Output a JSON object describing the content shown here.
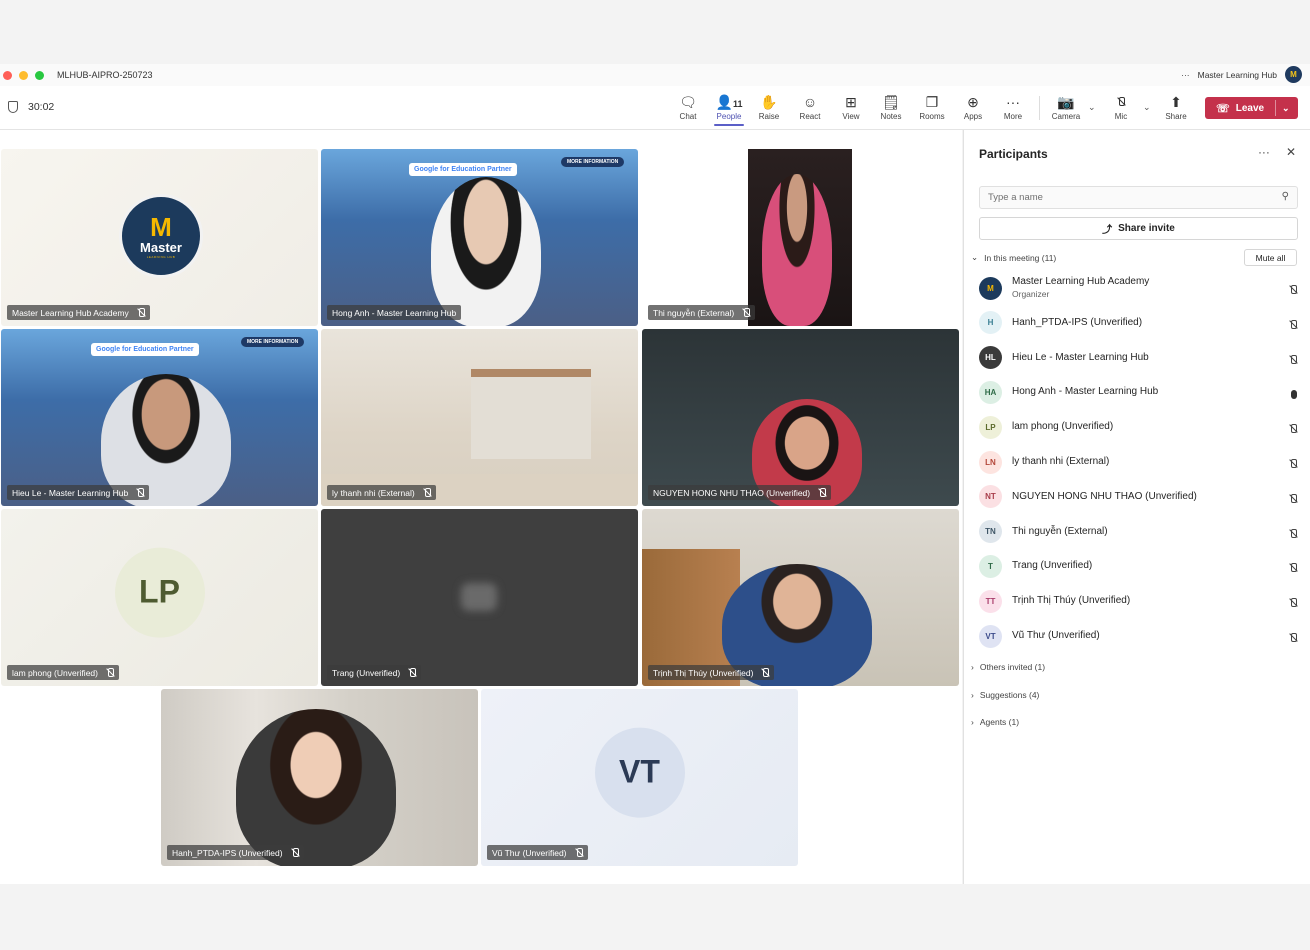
{
  "window": {
    "title": "MLHUB-AIPRO-250723",
    "org_name": "Master Learning Hub",
    "org_avatar": "M"
  },
  "toolbar": {
    "timer": "30:02",
    "chat": "Chat",
    "people": "People",
    "people_count": "11",
    "raise": "Raise",
    "react": "React",
    "view": "View",
    "notes": "Notes",
    "rooms": "Rooms",
    "apps": "Apps",
    "more": "More",
    "camera": "Camera",
    "mic": "Mic",
    "share": "Share",
    "leave": "Leave"
  },
  "tiles": [
    {
      "name": "Master Learning Hub Academy"
    },
    {
      "name": "Hong Anh - Master Learning Hub"
    },
    {
      "name": "Thi nguyễn (External)"
    },
    {
      "name": "Hieu Le - Master Learning Hub"
    },
    {
      "name": "ly thanh nhi (External)"
    },
    {
      "name": "NGUYEN HONG NHU THAO (Unverified)"
    },
    {
      "name": "lam phong (Unverified)",
      "initials": "LP"
    },
    {
      "name": "Trang (Unverified)"
    },
    {
      "name": "Trịnh Thị Thúy (Unverified)"
    },
    {
      "name": "Hanh_PTDA-IPS (Unverified)"
    },
    {
      "name": "Vũ Thư (Unverified)",
      "initials": "VT"
    }
  ],
  "brand": {
    "logo_letter": "M",
    "logo_text": "Master",
    "logo_sub": "LEARNING HUB",
    "google_badge": "Google for Education Partner",
    "more_info": "MORE INFORMATION"
  },
  "sidebar": {
    "title": "Participants",
    "search_placeholder": "Type a name",
    "share_invite": "Share invite",
    "in_meeting": "In this meeting (11)",
    "mute_all": "Mute all",
    "participants": [
      {
        "initials": "M",
        "name": "Master Learning Hub Academy",
        "role": "Organizer",
        "avatar_color": "#1c3a5c",
        "text_color": "#f5b800",
        "mic": "off"
      },
      {
        "initials": "H",
        "name": "Hanh_PTDA-IPS (Unverified)",
        "avatar_color": "#e3f1f5",
        "text_color": "#3b7f93",
        "mic": "off"
      },
      {
        "initials": "HL",
        "name": "Hieu Le - Master Learning Hub",
        "avatar_color": "#3a3a3a",
        "text_color": "#ffffff",
        "mic": "off"
      },
      {
        "initials": "HA",
        "name": "Hong Anh - Master Learning Hub",
        "avatar_color": "#dcefe4",
        "text_color": "#2e6b47",
        "mic": "on"
      },
      {
        "initials": "LP",
        "name": "lam phong (Unverified)",
        "avatar_color": "#eef0d9",
        "text_color": "#5c6b2c",
        "mic": "off"
      },
      {
        "initials": "LN",
        "name": "ly thanh nhi (External)",
        "avatar_color": "#fde4e0",
        "text_color": "#b3473a",
        "mic": "off"
      },
      {
        "initials": "NT",
        "name": "NGUYEN HONG NHU THAO (Unverified)",
        "avatar_color": "#fbe0e3",
        "text_color": "#a83c4a",
        "mic": "off"
      },
      {
        "initials": "TN",
        "name": "Thi nguyễn (External)",
        "avatar_color": "#dfe6ec",
        "text_color": "#3e5566",
        "mic": "off"
      },
      {
        "initials": "T",
        "name": "Trang (Unverified)",
        "avatar_color": "#dcefe4",
        "text_color": "#2e6b47",
        "mic": "off"
      },
      {
        "initials": "TT",
        "name": "Trịnh Thị Thúy (Unverified)",
        "avatar_color": "#fbe0ea",
        "text_color": "#a83c6a",
        "mic": "off"
      },
      {
        "initials": "VT",
        "name": "Vũ Thư (Unverified)",
        "avatar_color": "#dfe3f3",
        "text_color": "#3b4a8a",
        "mic": "off"
      }
    ],
    "others_invited": "Others invited (1)",
    "suggestions": "Suggestions (4)",
    "agents": "Agents (1)"
  }
}
